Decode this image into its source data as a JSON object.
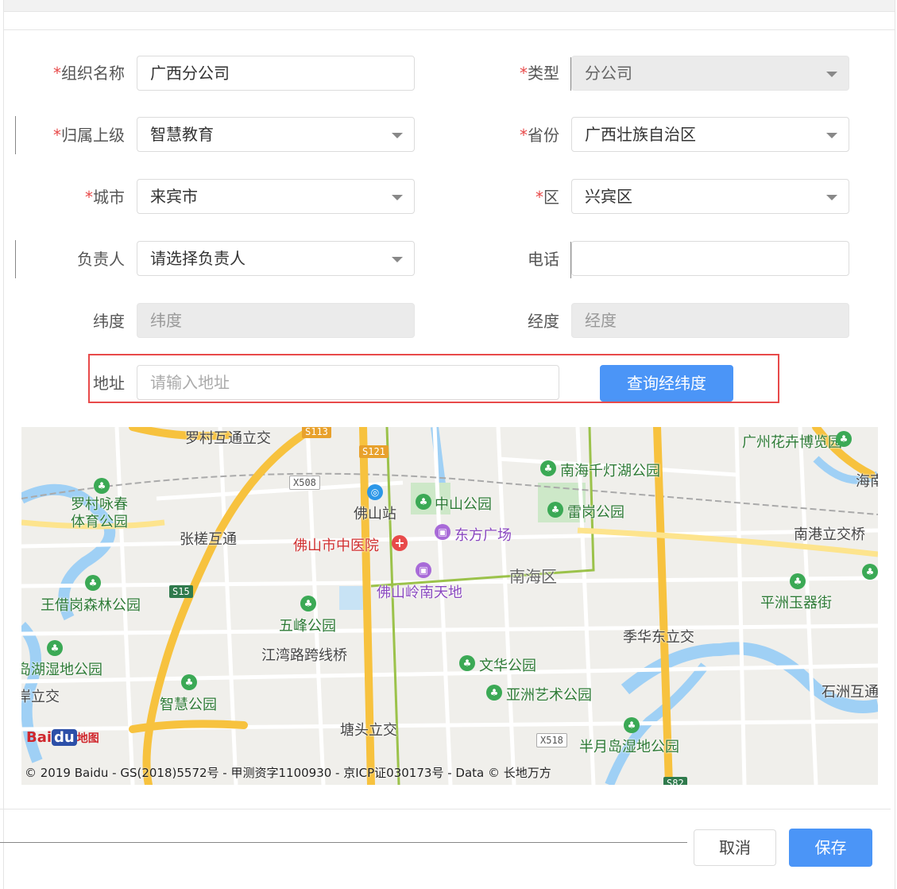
{
  "form": {
    "org_name": {
      "label": "组织名称",
      "value": "广西分公司"
    },
    "type": {
      "label": "类型",
      "value": "分公司"
    },
    "parent": {
      "label": "归属上级",
      "value": "智慧教育"
    },
    "province": {
      "label": "省份",
      "value": "广西壮族自治区"
    },
    "city": {
      "label": "城市",
      "value": "来宾市"
    },
    "district": {
      "label": "区",
      "value": "兴宾区"
    },
    "manager": {
      "label": "负责人",
      "placeholder": "请选择负责人"
    },
    "phone": {
      "label": "电话",
      "value": ""
    },
    "latitude": {
      "label": "纬度",
      "placeholder": "纬度"
    },
    "longitude": {
      "label": "经度",
      "placeholder": "经度"
    },
    "address": {
      "label": "地址",
      "placeholder": "请输入地址"
    },
    "required_mark": "*",
    "query_button": "查询经纬度"
  },
  "map": {
    "labels": {
      "luocun_jct": "罗村互通立交",
      "guangzhou_flower": "广州花卉博览园",
      "nanhai_qiandeng": "南海千灯湖公园",
      "hai": "海南",
      "luocun_park": "罗村咏春\n体育公园",
      "foshan_station": "佛山站",
      "zhongshan_park": "中山公园",
      "leigang_park": "雷岗公园",
      "nangang_jct": "南港立交桥",
      "zhangcha_jct": "张槎互通",
      "foshan_hospital": "佛山市中医院",
      "dongfang_plaza": "东方广场",
      "nanhai_district": "南海区",
      "wangjiegang_park": "王借岗森林公园",
      "lingnan_tiandi": "佛山岭南天地",
      "pingzhou_street": "平洲玉器街",
      "wufeng_park": "五峰公园",
      "jihua_east_jct": "季华东立交",
      "jiangwan_bridge": "江湾路跨线桥",
      "wetland_park": "岛湖湿地公园",
      "wenhua_park": "文华公园",
      "shizhou_jct": "石洲互通",
      "yazhou_park": "亚洲艺术公园",
      "li_jct": "岸立交",
      "zhihui_park": "智慧公园",
      "tangtou_jct": "塘头立交",
      "banyuedao_park": "半月岛湿地公园"
    },
    "shields": {
      "s113": "S113",
      "s121": "S121",
      "x508": "X508",
      "s15": "S15",
      "x518": "X518",
      "s82": "S82"
    },
    "logo_text": "Bai",
    "logo_paw": "du",
    "logo_suffix": "地图",
    "copyright": "© 2019 Baidu - GS(2018)5572号 - 甲测资字1100930 - 京ICP证030173号 - Data © 长地万方"
  },
  "footer": {
    "cancel": "取消",
    "save": "保存"
  }
}
